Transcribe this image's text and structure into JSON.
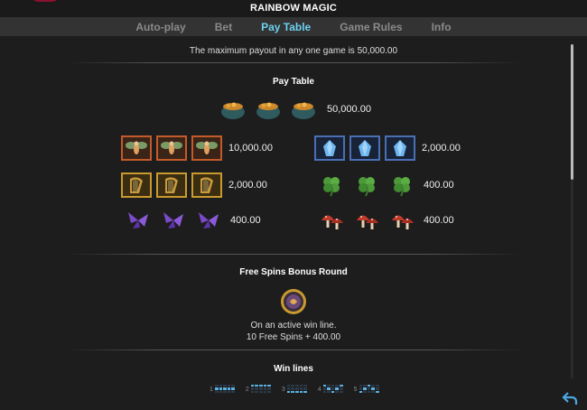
{
  "app": {
    "title": "RAINBOW MAGIC"
  },
  "tabs": [
    {
      "label": "Auto-play",
      "active": false
    },
    {
      "label": "Bet",
      "active": false
    },
    {
      "label": "Pay Table",
      "active": true
    },
    {
      "label": "Game Rules",
      "active": false
    },
    {
      "label": "Info",
      "active": false
    }
  ],
  "max_payout_text": "The maximum payout in any one game is 50,000.00",
  "paytable": {
    "title": "Pay Table",
    "top_row": {
      "symbol": "pot-of-gold-icon",
      "count": 3,
      "payout": "50,000.00"
    },
    "rows": [
      {
        "symbol": "fairy-icon",
        "count": 3,
        "frame": "red",
        "payout": "10,000.00"
      },
      {
        "symbol": "blue-crystal-icon",
        "count": 3,
        "frame": "blue",
        "payout": "2,000.00"
      },
      {
        "symbol": "harp-icon",
        "count": 3,
        "frame": "gold",
        "payout": "2,000.00"
      },
      {
        "symbol": "clover-icon",
        "count": 3,
        "frame": "none",
        "payout": "400.00"
      },
      {
        "symbol": "butterfly-icon",
        "count": 3,
        "frame": "none",
        "payout": "400.00"
      },
      {
        "symbol": "mushroom-icon",
        "count": 3,
        "frame": "none",
        "payout": "400.00"
      }
    ]
  },
  "free_spins": {
    "title": "Free Spins Bonus Round",
    "symbol": "bonus-coin-icon",
    "line1": "On an active win line.",
    "line2": "10 Free Spins + 400.00"
  },
  "win_lines": {
    "title": "Win lines",
    "items": [
      "1",
      "2",
      "3",
      "4",
      "5"
    ]
  },
  "colors": {
    "accent": "#6dd0ef",
    "tab_inactive": "#8a8a8a",
    "tabbar": "#333333",
    "background": "#1d1d1d"
  }
}
